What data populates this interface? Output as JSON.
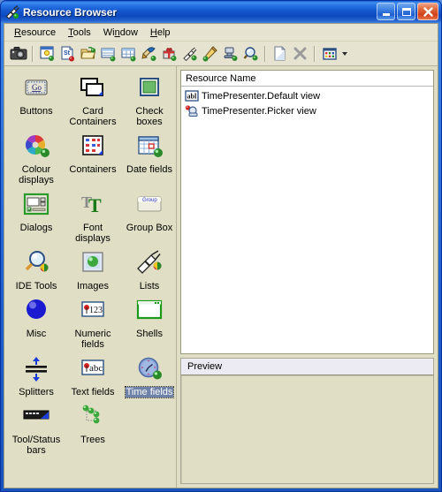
{
  "window": {
    "title": "Resource Browser",
    "icon": "plug-icon",
    "caption_buttons": [
      {
        "name": "minimize-button",
        "label": "Minimize",
        "glyph": "minimize-icon"
      },
      {
        "name": "maximize-button",
        "label": "Maximize",
        "glyph": "maximize-icon"
      },
      {
        "name": "close-button",
        "label": "Close",
        "glyph": "close-icon"
      }
    ],
    "colors": {
      "titlebar_blue": "#1356cc",
      "client_khaki": "#e0dec4",
      "toolbar_bg": "#e6e4d0",
      "selection_blue": "#6e82a8",
      "list_bg": "#ffffff"
    }
  },
  "menubar": {
    "items": [
      {
        "label": "Resource",
        "accel": "R"
      },
      {
        "label": "Tools",
        "accel": "T"
      },
      {
        "label": "Window",
        "accel": "n"
      },
      {
        "label": "Help",
        "accel": "H"
      }
    ]
  },
  "toolbar": {
    "buttons": [
      {
        "name": "camera-button",
        "icon": "camera-icon"
      },
      {
        "name": "new-window-button",
        "icon": "window-new-icon"
      },
      {
        "name": "smalltalk-file-button",
        "icon": "document-st-icon"
      },
      {
        "name": "open-folder-button",
        "icon": "folder-open-icon"
      },
      {
        "name": "list-view-button",
        "icon": "list-rows-icon"
      },
      {
        "name": "detail-view-button",
        "icon": "table-grid-icon"
      },
      {
        "name": "paint-button",
        "icon": "paint-brush-icon"
      },
      {
        "name": "package-button",
        "icon": "gift-package-icon"
      },
      {
        "name": "plug-button",
        "icon": "plug-icon"
      },
      {
        "name": "edit-pencil-button",
        "icon": "pencil-icon"
      },
      {
        "name": "inspect-button",
        "icon": "inspector-icon"
      },
      {
        "name": "browse-button",
        "icon": "magnifier-icon"
      },
      {
        "name": "new-resource-button",
        "icon": "blank-page-icon"
      },
      {
        "name": "delete-resource-button",
        "icon": "x-delete-icon"
      },
      {
        "name": "view-options-button",
        "icon": "view-grid-icon"
      }
    ],
    "separators_after": [
      0,
      11,
      13
    ],
    "dropdown": {
      "name": "view-options-dropdown",
      "icon": "chevron-down-icon"
    }
  },
  "palette": {
    "selected": "Time fields",
    "items": [
      {
        "label": "Buttons",
        "icon": "button-go-icon"
      },
      {
        "label": "Card Containers",
        "icon": "card-stack-icon"
      },
      {
        "label": "Check boxes",
        "icon": "checkbox-green-icon"
      },
      {
        "label": "Colour displays",
        "icon": "colour-wheel-icon"
      },
      {
        "label": "Containers",
        "icon": "container-grid-icon"
      },
      {
        "label": "Date fields",
        "icon": "calendar-icon"
      },
      {
        "label": "Dialogs",
        "icon": "dialog-window-icon"
      },
      {
        "label": "Font displays",
        "icon": "font-tt-icon"
      },
      {
        "label": "Group Box",
        "icon": "group-box-icon"
      },
      {
        "label": "IDE Tools",
        "icon": "magnifier-tools-icon"
      },
      {
        "label": "Images",
        "icon": "image-sphere-icon"
      },
      {
        "label": "Lists",
        "icon": "plug-list-icon"
      },
      {
        "label": "Misc",
        "icon": "blue-sphere-icon"
      },
      {
        "label": "Numeric fields",
        "icon": "numeric-123-icon"
      },
      {
        "label": "Shells",
        "icon": "shell-window-icon"
      },
      {
        "label": "Splitters",
        "icon": "splitter-arrows-icon"
      },
      {
        "label": "Text fields",
        "icon": "text-abc-icon"
      },
      {
        "label": "Time fields",
        "icon": "clock-icon"
      },
      {
        "label": "Tool/Status bars",
        "icon": "toolbar-strip-icon"
      },
      {
        "label": "Trees",
        "icon": "tree-nodes-icon"
      }
    ]
  },
  "resource_list": {
    "header": "Resource Name",
    "rows": [
      {
        "name": "TimePresenter.Default view",
        "icon": "text-field-abl-icon"
      },
      {
        "name": "TimePresenter.Picker view",
        "icon": "picker-icon"
      }
    ]
  },
  "preview": {
    "header": "Preview",
    "content": ""
  }
}
